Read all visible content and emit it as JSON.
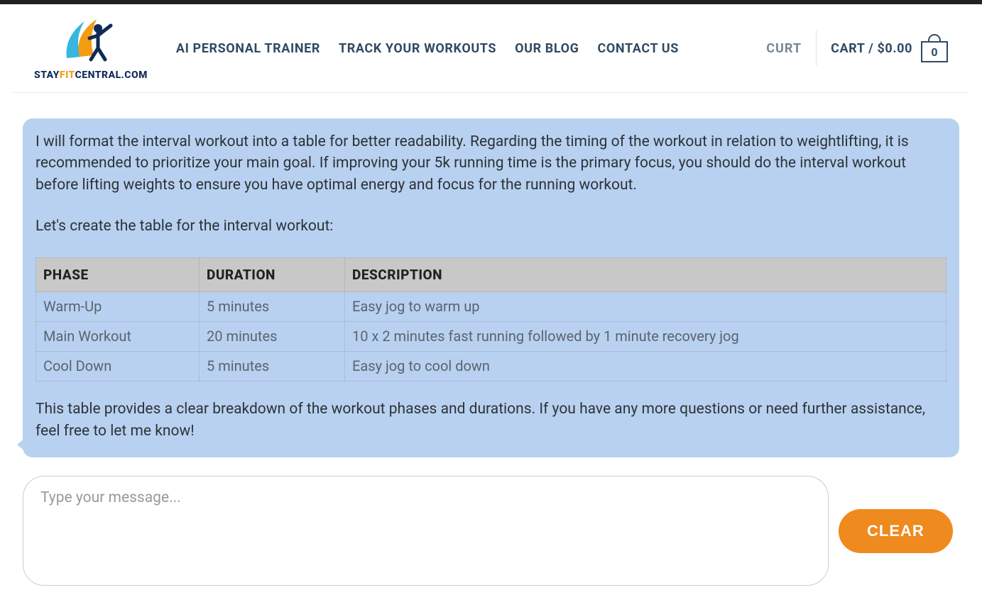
{
  "logo": {
    "text_stay": "STAY",
    "text_fit": "FIT",
    "text_central": "CENTRAL.COM"
  },
  "nav": {
    "items": [
      "AI PERSONAL TRAINER",
      "TRACK YOUR WORKOUTS",
      "OUR BLOG",
      "CONTACT US"
    ]
  },
  "user": {
    "name": "CURT"
  },
  "cart": {
    "label_prefix": "CART / ",
    "amount": "$0.00",
    "count": "0"
  },
  "chat": {
    "intro_p1": "I will format the interval workout into a table for better readability. Regarding the timing of the workout in relation to weightlifting, it is recommended to prioritize your main goal. If improving your 5k running time is the primary focus, you should do the interval workout before lifting weights to ensure you have optimal energy and focus for the running workout.",
    "intro_p2": "Let's create the table for the interval workout:",
    "outro": "This table provides a clear breakdown of the workout phases and durations. If you have any more questions or need further assistance, feel free to let me know!",
    "table": {
      "headers": [
        "PHASE",
        "DURATION",
        "DESCRIPTION"
      ],
      "rows": [
        {
          "phase": "Warm-Up",
          "duration": "5 minutes",
          "description": "Easy jog to warm up"
        },
        {
          "phase": "Main Workout",
          "duration": "20 minutes",
          "description": "10 x 2 minutes fast running followed by 1 minute recovery jog"
        },
        {
          "phase": "Cool Down",
          "duration": "5 minutes",
          "description": "Easy jog to cool down"
        }
      ]
    }
  },
  "input": {
    "placeholder": "Type your message...",
    "clear_label": "CLEAR"
  }
}
